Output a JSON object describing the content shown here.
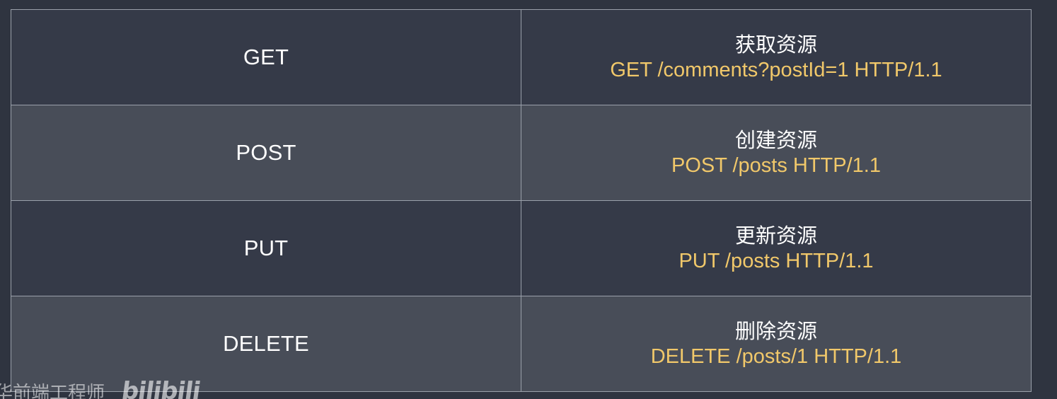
{
  "rows": [
    {
      "method": "GET",
      "description": "获取资源",
      "request": "GET /comments?postId=1 HTTP/1.1"
    },
    {
      "method": "POST",
      "description": "创建资源",
      "request": "POST /posts HTTP/1.1"
    },
    {
      "method": "PUT",
      "description": "更新资源",
      "request": "PUT /posts HTTP/1.1"
    },
    {
      "method": "DELETE",
      "description": "删除资源",
      "request": "DELETE /posts/1 HTTP/1.1"
    }
  ],
  "watermark": {
    "text": "华前端工程师",
    "logo": "bilibili"
  },
  "colors": {
    "background": "#2f3440",
    "row_dark": "#353a48",
    "row_light": "#484d58",
    "request_text": "#f1c86a",
    "border": "#9aa0aa"
  }
}
